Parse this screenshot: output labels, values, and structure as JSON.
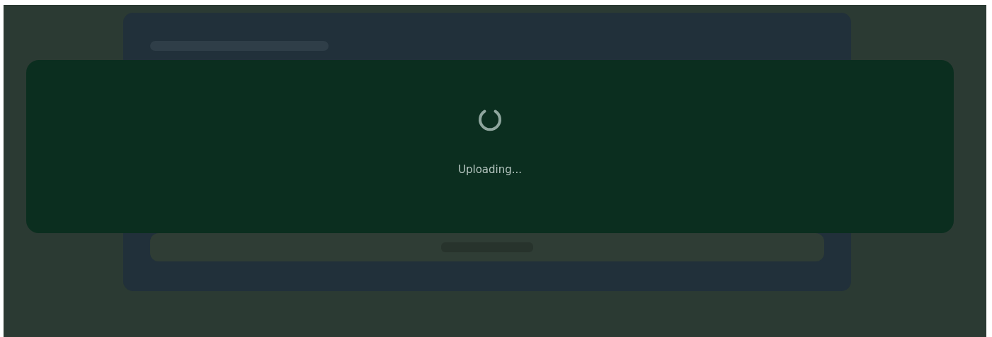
{
  "upload_overlay": {
    "status": "Uploading..."
  }
}
